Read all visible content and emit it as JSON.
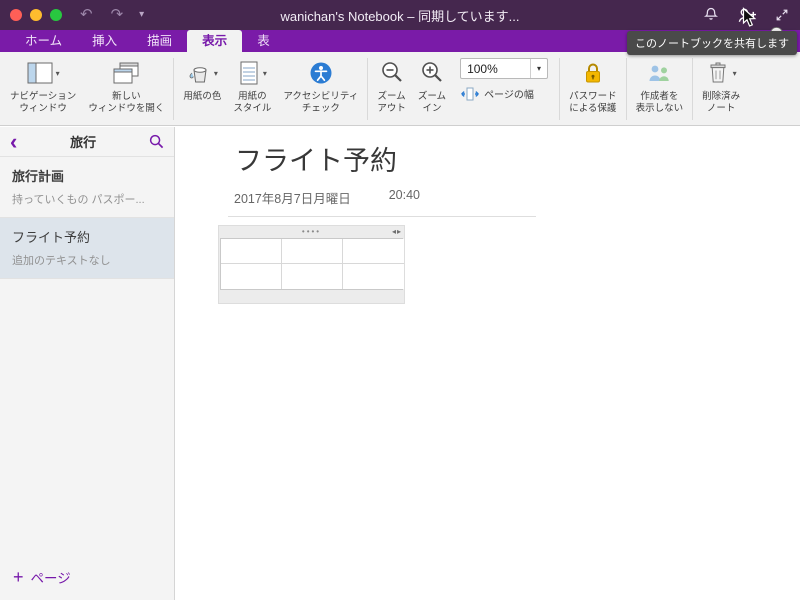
{
  "colors": {
    "titlebar_bg": "#45274e",
    "tabbar_bg": "#7a1ba8",
    "accent_purple": "#7719aa",
    "selected_page_bg": "#dde4eb",
    "tooltip_bg": "#4a4a4a",
    "lock_yellow": "#f3b700",
    "accessibility_blue": "#2b7cd3"
  },
  "icons": {
    "undo": "↶",
    "redo": "↷",
    "caret_down": "▾",
    "back_chevron": "‹",
    "plus": "+",
    "table_handle_dots": "••••",
    "table_handle_arrows": "◂▸"
  },
  "titlebar": {
    "title": "wanichan's Notebook – 同期しています..."
  },
  "tooltip": {
    "text": "このノートブックを共有します"
  },
  "tabs": [
    {
      "label": "ホーム",
      "active": false
    },
    {
      "label": "挿入",
      "active": false
    },
    {
      "label": "描画",
      "active": false
    },
    {
      "label": "表示",
      "active": true
    },
    {
      "label": "表",
      "active": false
    }
  ],
  "ribbon": {
    "zoom_value": "100%",
    "buttons": [
      {
        "label": "ナビゲーション\nウィンドウ",
        "icon": "navigation-pane",
        "dropdown": true
      },
      {
        "label": "新しい\nウィンドウを開く",
        "icon": "new-window",
        "dropdown": false
      },
      {
        "label": "用紙の色",
        "icon": "page-color",
        "dropdown": true
      },
      {
        "label": "用紙の\nスタイル",
        "icon": "page-style",
        "dropdown": true
      },
      {
        "label": "アクセシビリティ\nチェック",
        "icon": "accessibility-check",
        "dropdown": false
      },
      {
        "label": "ズーム\nアウト",
        "icon": "zoom-out",
        "dropdown": false
      },
      {
        "label": "ズーム\nイン",
        "icon": "zoom-in",
        "dropdown": false
      },
      {
        "label": "ページの幅",
        "icon": "page-width",
        "dropdown": false
      },
      {
        "label": "パスワード\nによる保護",
        "icon": "password-protect",
        "dropdown": false
      },
      {
        "label": "作成者を\n表示しない",
        "icon": "hide-authors",
        "dropdown": false
      },
      {
        "label": "削除済み\nノート",
        "icon": "deleted-notes",
        "dropdown": true
      }
    ]
  },
  "sidebar": {
    "section_title": "旅行",
    "pages": [
      {
        "title": "旅行計画",
        "subtitle": "持っていくもの パスポー...",
        "selected": false
      },
      {
        "title": "フライト予約",
        "subtitle": "追加のテキストなし",
        "selected": true
      }
    ],
    "add_page_label": "ページ"
  },
  "content": {
    "page_title": "フライト予約",
    "date": "2017年8月7日月曜日",
    "time": "20:40",
    "table": {
      "rows": 2,
      "cols": 3
    }
  }
}
